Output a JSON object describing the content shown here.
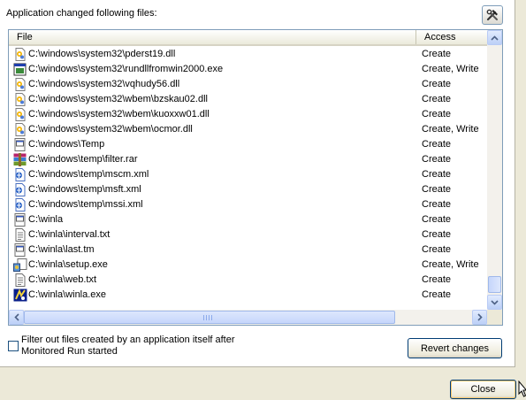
{
  "heading": "Application changed following files:",
  "columns": {
    "file": "File",
    "access": "Access"
  },
  "rows": [
    {
      "icon": "dll-icon",
      "path": "C:\\windows\\system32\\pderst19.dll",
      "access": "Create"
    },
    {
      "icon": "exe-icon",
      "path": "C:\\windows\\system32\\rundllfromwin2000.exe",
      "access": "Create, Write"
    },
    {
      "icon": "dll-icon",
      "path": "C:\\windows\\system32\\vqhudy56.dll",
      "access": "Create"
    },
    {
      "icon": "dll-icon",
      "path": "C:\\windows\\system32\\wbem\\bzskau02.dll",
      "access": "Create"
    },
    {
      "icon": "dll-icon",
      "path": "C:\\windows\\system32\\wbem\\kuoxxw01.dll",
      "access": "Create"
    },
    {
      "icon": "dll-icon",
      "path": "C:\\windows\\system32\\wbem\\ocmor.dll",
      "access": "Create, Write"
    },
    {
      "icon": "folder-file-icon",
      "path": "C:\\windows\\Temp",
      "access": "Create"
    },
    {
      "icon": "rar-archive-icon",
      "path": "C:\\windows\\temp\\filter.rar",
      "access": "Create"
    },
    {
      "icon": "xml-file-icon",
      "path": "C:\\windows\\temp\\mscm.xml",
      "access": "Create"
    },
    {
      "icon": "xml-file-icon",
      "path": "C:\\windows\\temp\\msft.xml",
      "access": "Create"
    },
    {
      "icon": "xml-file-icon",
      "path": "C:\\windows\\temp\\mssi.xml",
      "access": "Create"
    },
    {
      "icon": "folder-file-icon",
      "path": "C:\\winla",
      "access": "Create"
    },
    {
      "icon": "text-file-icon",
      "path": "C:\\winla\\interval.txt",
      "access": "Create"
    },
    {
      "icon": "folder-file-icon",
      "path": "C:\\winla\\last.tm",
      "access": "Create"
    },
    {
      "icon": "setup-exe-icon",
      "path": "C:\\winla\\setup.exe",
      "access": "Create, Write"
    },
    {
      "icon": "text-file-icon",
      "path": "C:\\winla\\web.txt",
      "access": "Create"
    },
    {
      "icon": "app-exe-icon",
      "path": "C:\\winla\\winla.exe",
      "access": "Create"
    }
  ],
  "filter_checkbox": {
    "checked": false,
    "label": "Filter out files created by an application itself after Monitored Run started"
  },
  "revert_label": "Revert changes",
  "close_label": "Close",
  "colors": {
    "dialog_bg": "#ece9d8",
    "border": "#7f9db9",
    "scrollbar": "#c6d6fb"
  }
}
